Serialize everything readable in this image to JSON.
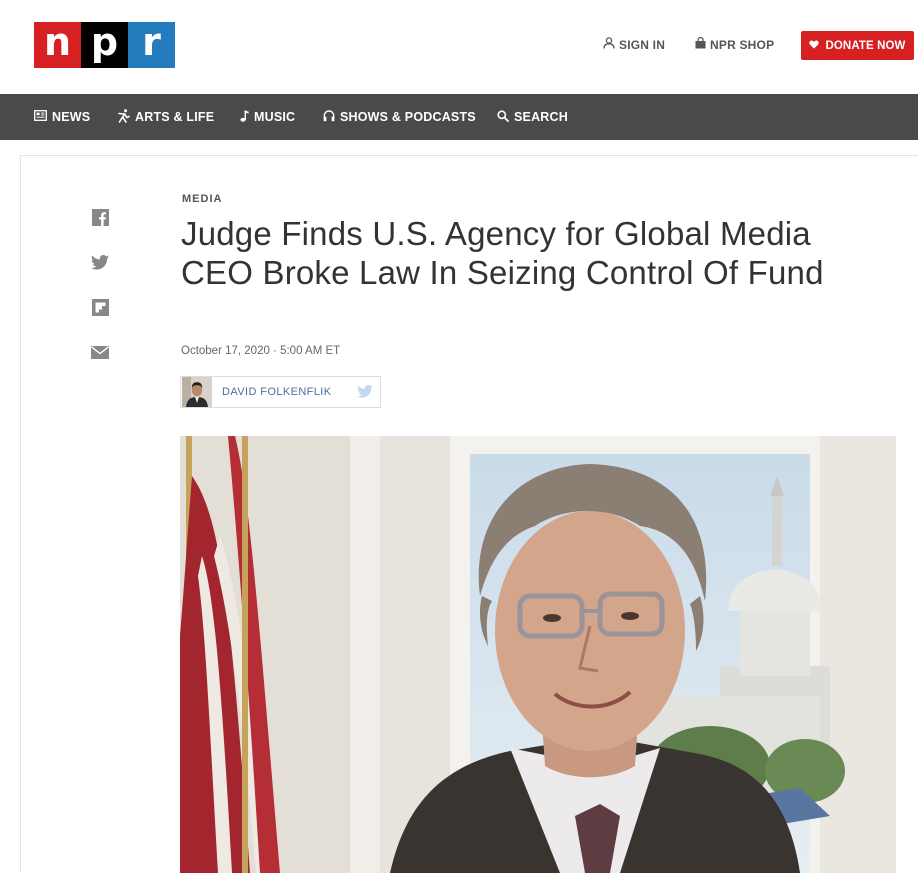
{
  "header": {
    "logo_letters": [
      "n",
      "p",
      "r"
    ],
    "logo_colors": [
      "#d62021",
      "#000000",
      "#237bbd"
    ],
    "sign_in_label": "SIGN IN",
    "shop_label": "NPR SHOP",
    "donate_label": "DONATE NOW",
    "donate_color": "#d62021"
  },
  "nav": {
    "background": "#4a4a4a",
    "items": [
      {
        "label": "NEWS",
        "icon": "news-icon"
      },
      {
        "label": "ARTS & LIFE",
        "icon": "arts-life-icon"
      },
      {
        "label": "MUSIC",
        "icon": "music-note-icon"
      },
      {
        "label": "SHOWS & PODCASTS",
        "icon": "headphones-icon"
      },
      {
        "label": "SEARCH",
        "icon": "search-icon"
      }
    ]
  },
  "share": {
    "icons": [
      "facebook-icon",
      "twitter-icon",
      "flipboard-icon",
      "email-icon"
    ]
  },
  "article": {
    "slug": "MEDIA",
    "headline": "Judge Finds U.S. Agency for Global Media CEO Broke Law In Seizing Control Of Fund",
    "date": "October 17, 2020 · 5:00 AM ET",
    "author": "DAVID FOLKENFLIK",
    "author_twitter_icon": "twitter-icon"
  }
}
